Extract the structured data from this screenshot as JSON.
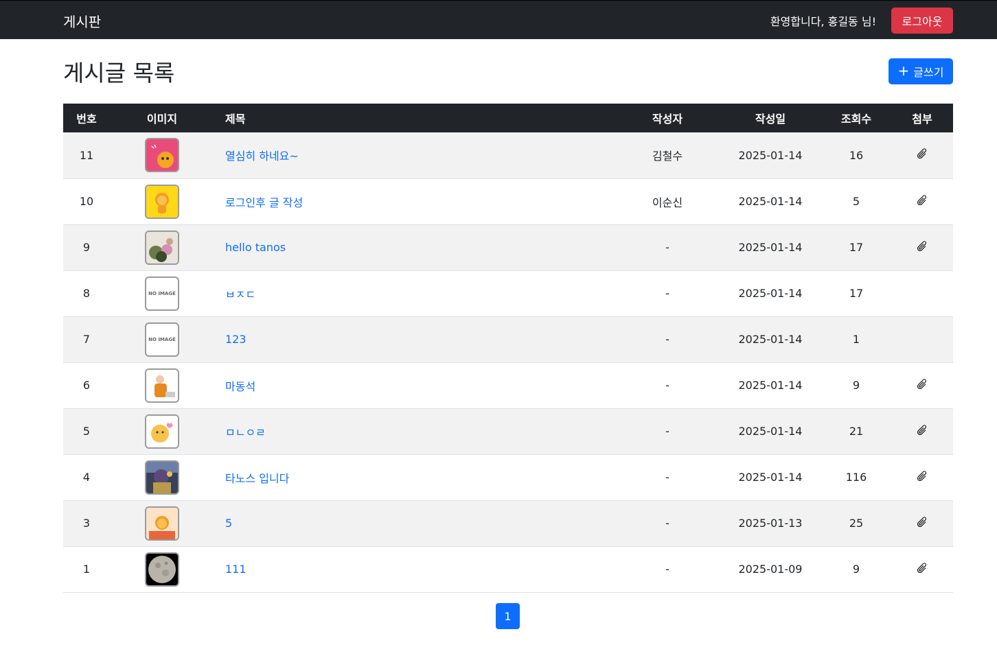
{
  "navbar": {
    "brand": "게시판",
    "welcome": "환영합니다, 홍길동 님!",
    "logout_label": "로그아웃"
  },
  "page": {
    "title": "게시글 목록",
    "write_label": "글쓰기"
  },
  "table": {
    "headers": {
      "num": "번호",
      "image": "이미지",
      "title": "제목",
      "author": "작성자",
      "date": "작성일",
      "views": "조회수",
      "attach": "첨부"
    },
    "rows": [
      {
        "num": "11",
        "image": "pink-character",
        "title": "열심히 하네요~",
        "author": "김철수",
        "date": "2025-01-14",
        "views": "16",
        "attach": true
      },
      {
        "num": "10",
        "image": "yellow-lion",
        "title": "로그인후 글 작성",
        "author": "이순신",
        "date": "2025-01-14",
        "views": "5",
        "attach": true
      },
      {
        "num": "9",
        "image": "photo-flowers",
        "title": "hello tanos",
        "author": "-",
        "date": "2025-01-14",
        "views": "17",
        "attach": true
      },
      {
        "num": "8",
        "image": "no-image",
        "title": "ㅂㅈㄷ",
        "author": "-",
        "date": "2025-01-14",
        "views": "17",
        "attach": false
      },
      {
        "num": "7",
        "image": "no-image",
        "title": "123",
        "author": "-",
        "date": "2025-01-14",
        "views": "1",
        "attach": false
      },
      {
        "num": "6",
        "image": "man-laptop",
        "title": "마동석",
        "author": "-",
        "date": "2025-01-14",
        "views": "9",
        "attach": true
      },
      {
        "num": "5",
        "image": "lion-hearts",
        "title": "ㅁㄴㅇㄹ",
        "author": "-",
        "date": "2025-01-14",
        "views": "21",
        "attach": true
      },
      {
        "num": "4",
        "image": "tanos-art",
        "title": "타노스 입니다",
        "author": "-",
        "date": "2025-01-14",
        "views": "116",
        "attach": true
      },
      {
        "num": "3",
        "image": "lion-orange",
        "title": "5",
        "author": "-",
        "date": "2025-01-13",
        "views": "25",
        "attach": true
      },
      {
        "num": "1",
        "image": "moon",
        "title": "111",
        "author": "-",
        "date": "2025-01-09",
        "views": "9",
        "attach": true
      }
    ],
    "no_image_text": "NO IMAGE"
  },
  "pagination": {
    "current": "1"
  },
  "colors": {
    "navbar": "#212529",
    "danger": "#dc3545",
    "primary": "#0d6efd",
    "stripe": "#f2f2f2"
  }
}
